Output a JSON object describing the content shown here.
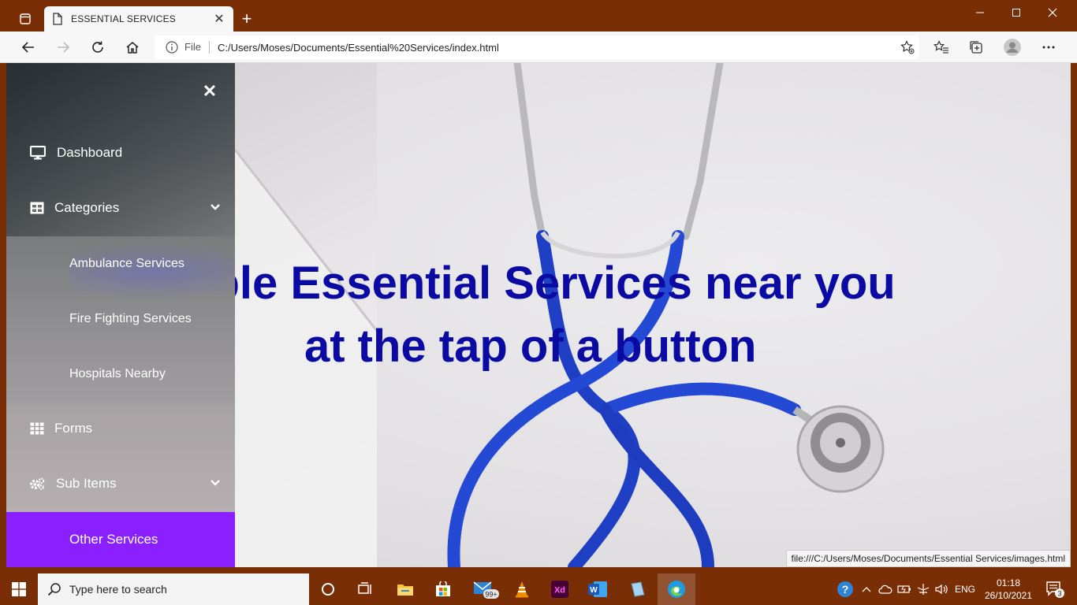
{
  "browser": {
    "tab_title": "ESSENTIAL SERVICES",
    "new_tab": "+",
    "address_prefix": "File",
    "address_url": "C:/Users/Moses/Documents/Essential%20Services/index.html",
    "status_url": "file:///C:/Users/Moses/Documents/Essential Services/images.html"
  },
  "sidebar": {
    "close": "✕",
    "items": [
      {
        "label": "Dashboard",
        "icon": "desktop-icon"
      },
      {
        "label": "Categories",
        "icon": "grid-icon"
      },
      {
        "label": "Forms",
        "icon": "table-icon"
      },
      {
        "label": "Sub Items",
        "icon": "cogs-icon"
      }
    ],
    "sub_items": [
      "Ambulance Services",
      "Fire Fighting Services",
      "Hospitals Nearby"
    ],
    "active_item": "Other Services",
    "active_color": "#8a1fff"
  },
  "hero": {
    "line1": "liable Essential Services near you",
    "line2": "at the tap of a button",
    "color": "#0b0ba4"
  },
  "taskbar": {
    "search_placeholder": "Type here to search",
    "mail_badge": "99+",
    "language": "ENG",
    "time": "01:18",
    "date": "26/10/2021",
    "notifications": "3"
  }
}
